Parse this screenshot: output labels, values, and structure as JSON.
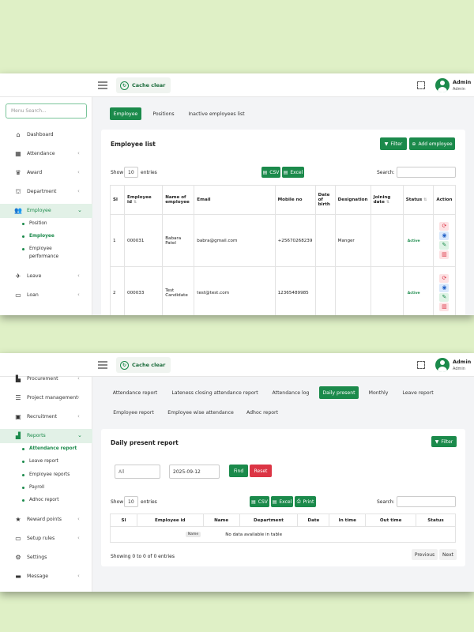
{
  "top": {
    "cache_label": "Cache clear",
    "user_name": "Admin",
    "user_role": "Admin"
  },
  "shot1": {
    "menu_search_placeholder": "Menu Search...",
    "sidebar": [
      {
        "label": "Dashboard",
        "icon": "home-icon",
        "chevron": false
      },
      {
        "label": "Attendance",
        "icon": "calendar-icon",
        "chevron": true
      },
      {
        "label": "Award",
        "icon": "trophy-icon",
        "chevron": true
      },
      {
        "label": "Department",
        "icon": "bank-icon",
        "chevron": true
      },
      {
        "label": "Employee",
        "icon": "users-icon",
        "chevron": true,
        "active": true
      },
      {
        "label": "Leave",
        "icon": "plane-icon",
        "chevron": true
      },
      {
        "label": "Loan",
        "icon": "money-icon",
        "chevron": true
      }
    ],
    "sub_items": [
      "Position",
      "Employee",
      "Employee",
      "performance"
    ],
    "tabs": [
      "Employee",
      "Positions",
      "Inactive employees list"
    ],
    "card_title": "Employee list",
    "filter_label": "Filter",
    "add_label": "Add employee",
    "show_label": "Show",
    "show_value": "10",
    "entries_label": "entries",
    "csv_label": "CSV",
    "excel_label": "Excel",
    "search_label": "Search:",
    "columns": [
      "Sl",
      "Employee id",
      "Name of employee",
      "Email",
      "Mobile no",
      "Date of birth",
      "Designation",
      "Joining date",
      "Status",
      "Action"
    ],
    "rows": [
      {
        "sl": "1",
        "id": "000031",
        "name": "Babara Patel",
        "email": "babra@gmail.com",
        "mobile": "+25670268239",
        "dob": "",
        "designation": "Manger",
        "joining": "",
        "status": "Active"
      },
      {
        "sl": "2",
        "id": "000033",
        "name": "Test Candidate",
        "email": "test@test.com",
        "mobile": "12365489985",
        "dob": "",
        "designation": "",
        "joining": "",
        "status": "Active"
      }
    ]
  },
  "shot2": {
    "sidebar": [
      {
        "label": "Procurement",
        "icon": "cart-icon",
        "chevron": true
      },
      {
        "label": "Project management",
        "icon": "list-icon",
        "chevron": true
      },
      {
        "label": "Recruitment",
        "icon": "id-card-icon",
        "chevron": true
      },
      {
        "label": "Reports",
        "icon": "chart-icon",
        "chevron": true,
        "active": true
      },
      {
        "label": "Reward points",
        "icon": "star-icon",
        "chevron": true
      },
      {
        "label": "Setup rules",
        "icon": "rules-icon",
        "chevron": true
      },
      {
        "label": "Settings",
        "icon": "gear-icon",
        "chevron": false
      },
      {
        "label": "Message",
        "icon": "message-icon",
        "chevron": true
      }
    ],
    "sub_items": [
      "Attendance report",
      "Leave report",
      "Employee reports",
      "Payroll",
      "Adhoc report"
    ],
    "tabs_row1": [
      "Attendance report",
      "Lateness closing attendance report",
      "Attendance log",
      "Daily present",
      "Monthly",
      "Leave report"
    ],
    "tabs_row2": [
      "Employee report",
      "Employee wise attendance",
      "Adhoc report"
    ],
    "card_title": "Daily present report",
    "filter_label": "Filter",
    "select_value": "All",
    "date_value": "2025-09-12",
    "find_label": "Find",
    "reset_label": "Reset",
    "show_label": "Show",
    "show_value": "10",
    "entries_label": "entries",
    "csv_label": "CSV",
    "excel_label": "Excel",
    "print_label": "Print",
    "search_label": "Search:",
    "columns": [
      "Sl",
      "Employee id",
      "Name",
      "Department",
      "Date",
      "In time",
      "Out time",
      "Status"
    ],
    "tooltip": "Name",
    "empty_text": "No data available in table",
    "info_text": "Showing 0 to 0 of 0 entries",
    "previous_label": "Previous",
    "next_label": "Next"
  },
  "colors": {
    "accent": "#1b8a4b",
    "danger": "#dc3545",
    "background": "#dff0c6"
  }
}
